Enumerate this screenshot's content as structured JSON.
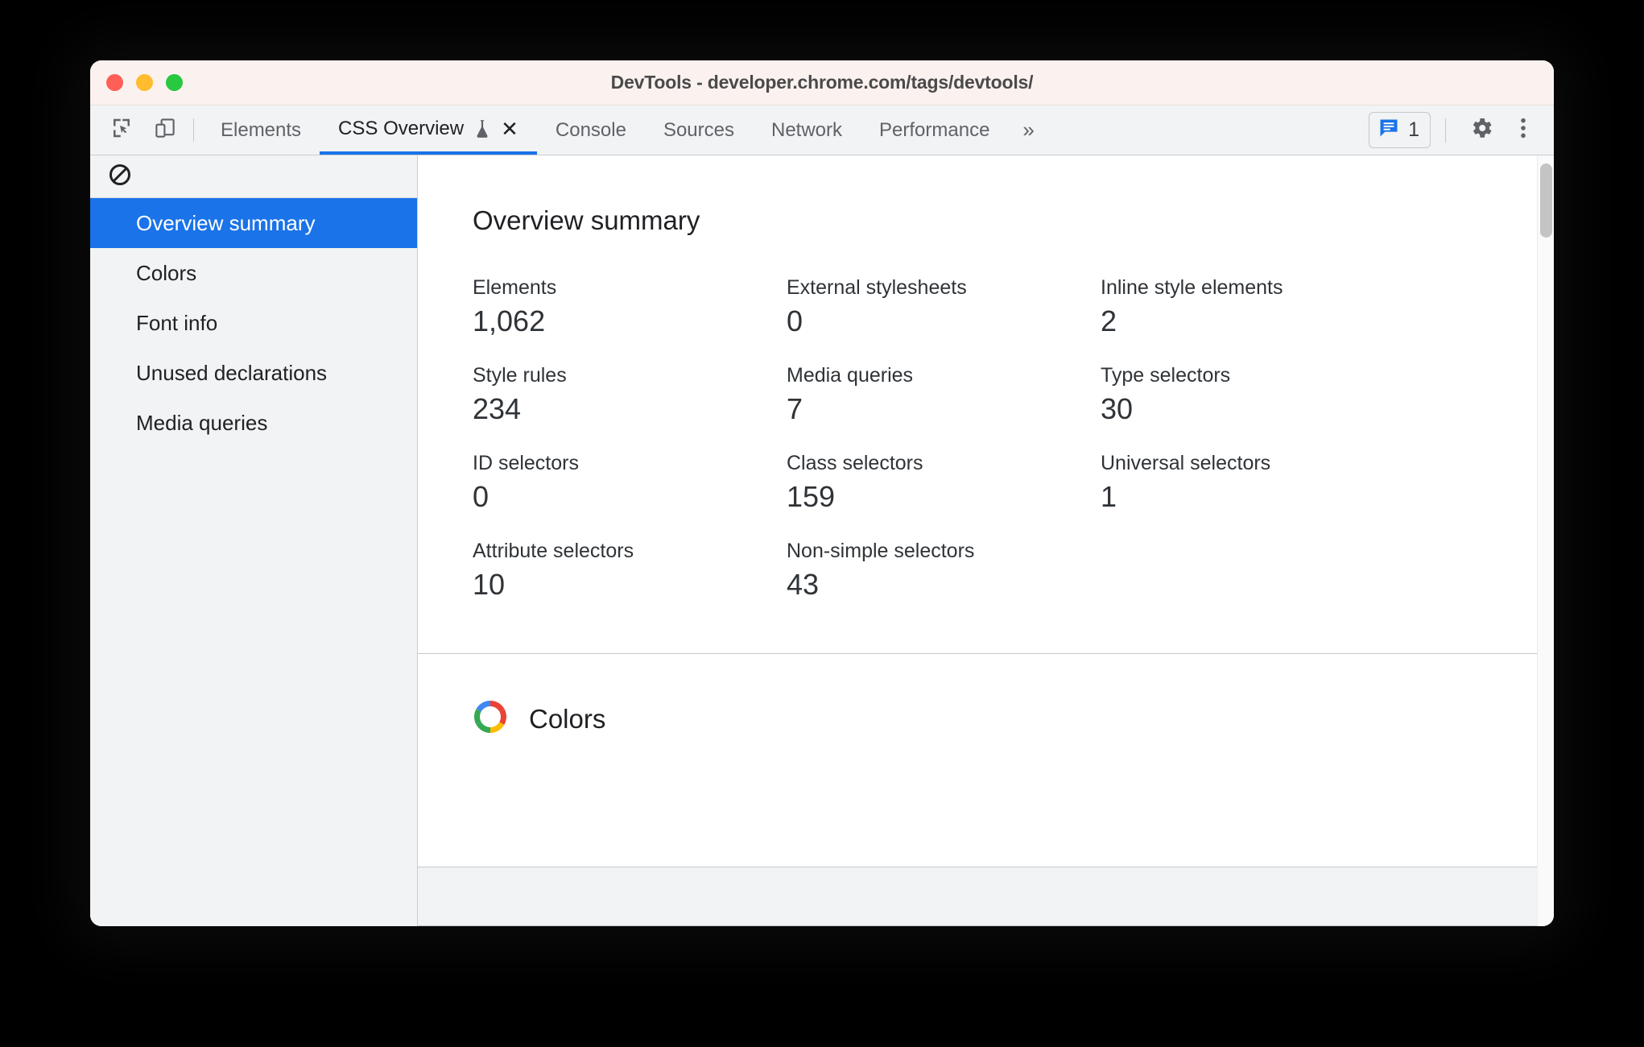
{
  "window": {
    "title": "DevTools - developer.chrome.com/tags/devtools/",
    "traffic_lights": {
      "close": "close-button",
      "minimize": "minimize-button",
      "maximize": "maximize-button"
    },
    "colors": {
      "close": "#FF5F57",
      "minimize": "#FEBC2E",
      "maximize": "#28C840",
      "titlebar_bg": "#FBF2F0"
    }
  },
  "toolbar": {
    "inspect_icon": "inspect-element-icon",
    "device_icon": "device-toolbar-icon",
    "tabs": [
      {
        "label": "Elements",
        "active": false
      },
      {
        "label": "CSS Overview",
        "active": true,
        "experimental": true,
        "closable": true
      },
      {
        "label": "Console",
        "active": false
      },
      {
        "label": "Sources",
        "active": false
      },
      {
        "label": "Network",
        "active": false
      },
      {
        "label": "Performance",
        "active": false
      }
    ],
    "more_tabs_label": "»",
    "message_count": "1",
    "message_icon": "console-message-icon",
    "settings_icon": "gear-icon",
    "menu_icon": "more-vertical-icon",
    "accent_color": "#1A73E8"
  },
  "sidebar": {
    "clear_icon": "clear-overview-icon",
    "items": [
      {
        "label": "Overview summary",
        "selected": true
      },
      {
        "label": "Colors",
        "selected": false
      },
      {
        "label": "Font info",
        "selected": false
      },
      {
        "label": "Unused declarations",
        "selected": false
      },
      {
        "label": "Media queries",
        "selected": false
      }
    ]
  },
  "main": {
    "summary": {
      "title": "Overview summary",
      "stats": [
        {
          "label": "Elements",
          "value": "1,062"
        },
        {
          "label": "External stylesheets",
          "value": "0"
        },
        {
          "label": "Inline style elements",
          "value": "2"
        },
        {
          "label": "Style rules",
          "value": "234"
        },
        {
          "label": "Media queries",
          "value": "7"
        },
        {
          "label": "Type selectors",
          "value": "30"
        },
        {
          "label": "ID selectors",
          "value": "0"
        },
        {
          "label": "Class selectors",
          "value": "159"
        },
        {
          "label": "Universal selectors",
          "value": "1"
        },
        {
          "label": "Attribute selectors",
          "value": "10"
        },
        {
          "label": "Non-simple selectors",
          "value": "43"
        }
      ]
    },
    "colors_section": {
      "title": "Colors",
      "icon": "color-wheel-icon",
      "wheel_colors": [
        "#4285F4",
        "#EA4335",
        "#FBBC04",
        "#34A853"
      ]
    }
  }
}
